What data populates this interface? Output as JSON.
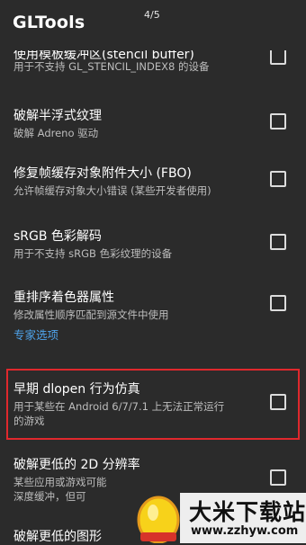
{
  "app": {
    "title": "GLTools",
    "page_indicator": "4/5"
  },
  "items": [
    {
      "title": "使用模板缓冲区(stencil buffer)",
      "summary": "用于不支持 GL_STENCIL_INDEX8 的设备",
      "checked": false
    },
    {
      "title": "破解半浮式纹理",
      "summary": "破解 Adreno 驱动",
      "checked": false
    },
    {
      "title": "修复帧缓存对象附件大小 (FBO)",
      "summary": "允许帧缓存对象大小错误 (某些开发者使用)",
      "checked": false
    },
    {
      "title": "sRGB 色彩解码",
      "summary": "用于不支持 sRGB 色彩纹理的设备",
      "checked": false
    },
    {
      "title": "重排序着色器属性",
      "summary": "修改属性顺序匹配到源文件中使用",
      "checked": false
    }
  ],
  "section": {
    "label": "专家选项"
  },
  "expert_items": [
    {
      "title": "早期 dlopen 行为仿真",
      "summary_line1": "用于某些在 Android 6/7/7.1 上无法正常运行",
      "summary_line2": "的游戏",
      "checked": false,
      "highlighted": true
    },
    {
      "title": "破解更低的 2D 分辨率",
      "summary_line1": "某些应用或游戏可能",
      "summary_line2": "深度缓冲，但可",
      "checked": false
    },
    {
      "title": "破解更低的图形",
      "checked": false
    }
  ],
  "watermark": {
    "brand": "大米下载站",
    "url": "www.zzhyw.com"
  },
  "colors": {
    "background": "#2b2b2b",
    "accent": "#4fa3ea",
    "highlight_border": "#e0282d"
  }
}
